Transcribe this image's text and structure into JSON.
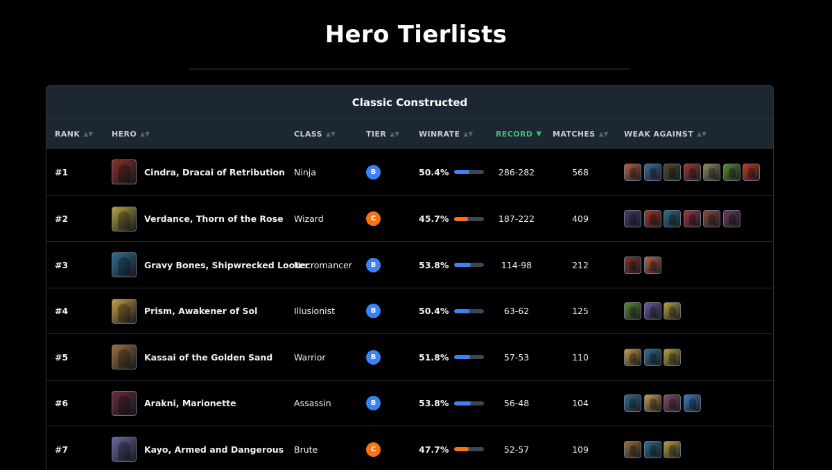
{
  "page": {
    "title": "Hero Tierlists"
  },
  "table": {
    "title": "Classic Constructed",
    "columns": {
      "rank": "RANK",
      "hero": "HERO",
      "class": "CLASS",
      "tier": "TIER",
      "winrate": "WINRATE",
      "record": "RECORD",
      "matches": "MATCHES",
      "weak_against": "WEAK AGAINST"
    },
    "sorted_by": "record",
    "sort_direction": "descending",
    "tier_colors": {
      "B": "#3b82f6",
      "C": "#f97316"
    },
    "rows": [
      {
        "rank": "#1",
        "hero": "Cindra, Dracai of Retribution",
        "hero_color": "#8a3226",
        "class": "Ninja",
        "tier": "B",
        "winrate": "50.4%",
        "winrate_value": 50.4,
        "record": "286-282",
        "matches": "568",
        "weak_against": [
          "#c0613a",
          "#3d6f9c",
          "#4e4a2a",
          "#9c3a2e",
          "#8f8a5a",
          "#5e8a32",
          "#c43a1e"
        ]
      },
      {
        "rank": "#2",
        "hero": "Verdance, Thorn of the Rose",
        "hero_color": "#b9a23c",
        "class": "Wizard",
        "tier": "C",
        "winrate": "45.7%",
        "winrate_value": 45.7,
        "record": "187-222",
        "matches": "409",
        "weak_against": [
          "#4a3a6a",
          "#b0341e",
          "#2e6f8a",
          "#a83040",
          "#8a4a3a",
          "#6a3a5a"
        ]
      },
      {
        "rank": "#3",
        "hero": "Gravy Bones, Shipwrecked Looter",
        "hero_color": "#2e6f8f",
        "class": "Necromancer",
        "tier": "B",
        "winrate": "53.8%",
        "winrate_value": 53.8,
        "record": "114-98",
        "matches": "212",
        "weak_against": [
          "#8a3226",
          "#c0613a"
        ]
      },
      {
        "rank": "#4",
        "hero": "Prism, Awakener of Sol",
        "hero_color": "#c9a040",
        "class": "Illusionist",
        "tier": "B",
        "winrate": "50.4%",
        "winrate_value": 50.4,
        "record": "63-62",
        "matches": "125",
        "weak_against": [
          "#5e8a32",
          "#6a5aa0",
          "#b9a23c"
        ]
      },
      {
        "rank": "#5",
        "hero": "Kassai of the Golden Sand",
        "hero_color": "#a0703a",
        "class": "Warrior",
        "tier": "B",
        "winrate": "51.8%",
        "winrate_value": 51.8,
        "record": "57-53",
        "matches": "110",
        "weak_against": [
          "#c9a040",
          "#2e6f8f",
          "#b9a23c"
        ]
      },
      {
        "rank": "#6",
        "hero": "Arakni, Marionette",
        "hero_color": "#6a2a3a",
        "class": "Assassin",
        "tier": "B",
        "winrate": "53.8%",
        "winrate_value": 53.8,
        "record": "56-48",
        "matches": "104",
        "weak_against": [
          "#2e6f8f",
          "#c9a040",
          "#8a4a6a",
          "#3a7ac0"
        ]
      },
      {
        "rank": "#7",
        "hero": "Kayo, Armed and Dangerous",
        "hero_color": "#6a6aa0",
        "class": "Brute",
        "tier": "C",
        "winrate": "47.7%",
        "winrate_value": 47.7,
        "record": "52-57",
        "matches": "109",
        "weak_against": [
          "#a0703a",
          "#2e6f8f",
          "#b9a23c"
        ]
      }
    ]
  }
}
